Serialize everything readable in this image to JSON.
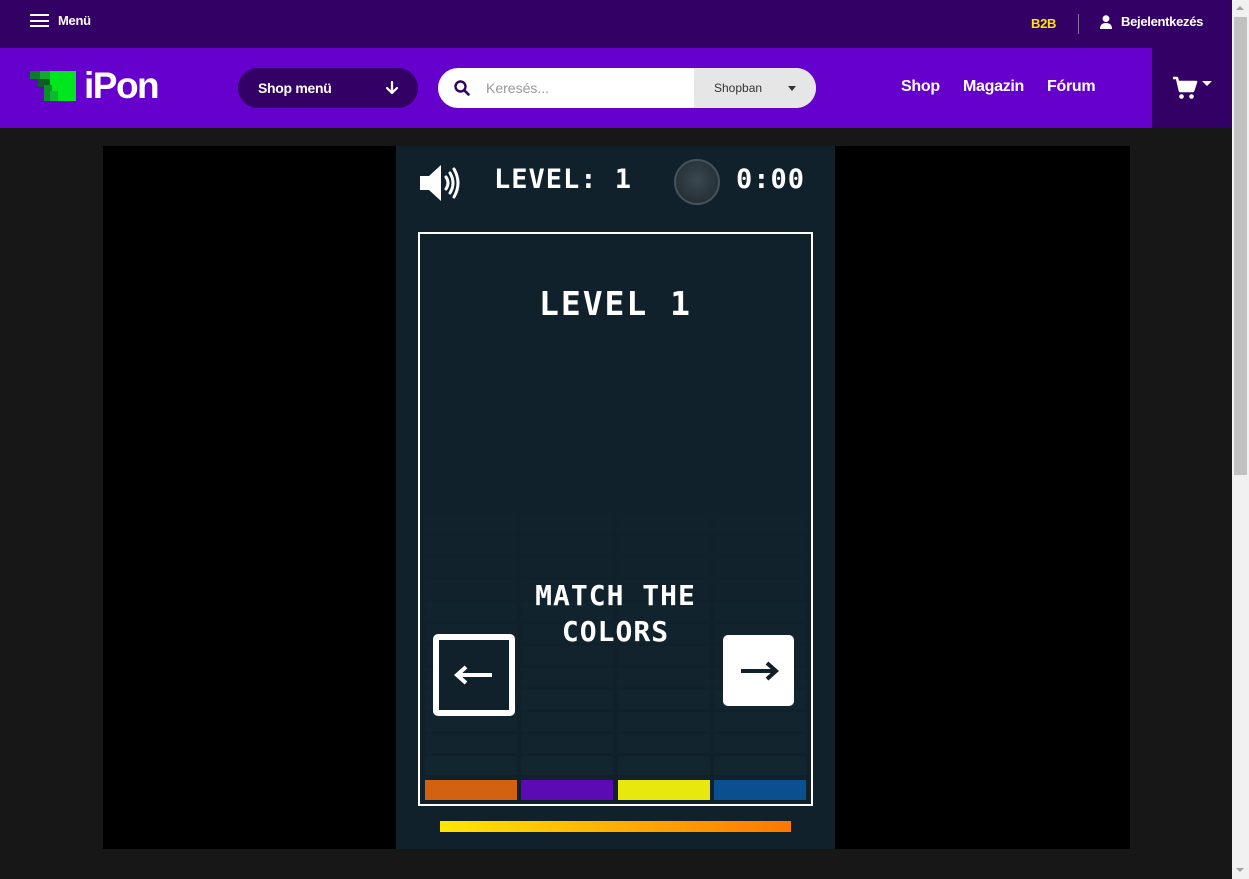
{
  "topbar": {
    "menu_label": "Menü",
    "b2b_label": "B2B",
    "login_label": "Bejelentkezés"
  },
  "header": {
    "logo_text": "iPon",
    "shop_menu_label": "Shop menü",
    "search_placeholder": "Keresés...",
    "search_scope": "Shopban",
    "nav": [
      "Shop",
      "Magazin",
      "Fórum"
    ]
  },
  "colors": {
    "topbar_bg": "#330066",
    "header_bg": "#6600cc",
    "b2b": "#ffe600",
    "game_bg": "#10212c",
    "logo_green": "#00e61e"
  },
  "game": {
    "hud_level": "LEVEL: 1",
    "hud_time": "0:00",
    "board_title": "LEVEL 1",
    "board_message_line1": "MATCH THE",
    "board_message_line2": "COLORS",
    "sound_state": "on",
    "bucket_colors": [
      "#d2620f",
      "#5c0ab3",
      "#e8e80c",
      "#0a4f8f"
    ],
    "timer_remaining": 1.0
  }
}
